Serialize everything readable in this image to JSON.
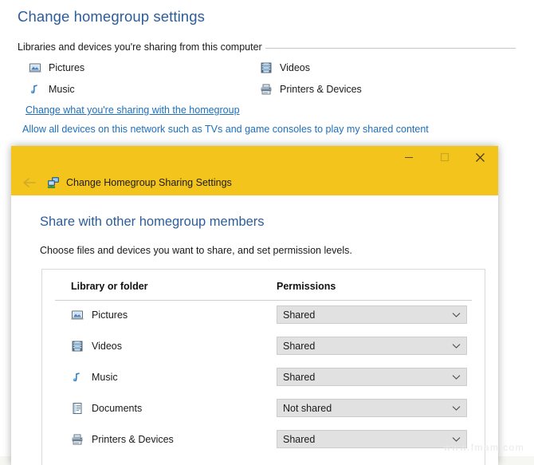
{
  "background_page": {
    "title": "Change homegroup settings",
    "group_label": "Libraries and devices you're sharing from this computer",
    "shared_items": [
      {
        "label": "Pictures",
        "icon": "pictures-icon"
      },
      {
        "label": "Videos",
        "icon": "videos-icon"
      },
      {
        "label": "Music",
        "icon": "music-icon"
      },
      {
        "label": "Printers & Devices",
        "icon": "printer-icon"
      }
    ],
    "links": [
      {
        "label": "Change what you're sharing with the homegroup",
        "underline": true
      },
      {
        "label": "Allow all devices on this network such as TVs and game consoles to play my shared content",
        "underline": false
      }
    ]
  },
  "dialog": {
    "title": "Change Homegroup Sharing Settings",
    "title_icon": "homegroup-icon",
    "back_icon": "back-arrow-icon",
    "window_controls": {
      "minimize": "minimize-icon",
      "maximize": "maximize-icon",
      "close": "close-icon"
    },
    "heading": "Share with other homegroup members",
    "subheading": "Choose files and devices you want to share, and set permission levels.",
    "table": {
      "headers": {
        "library": "Library or folder",
        "permissions": "Permissions"
      },
      "rows": [
        {
          "label": "Pictures",
          "icon": "pictures-icon",
          "permission": "Shared"
        },
        {
          "label": "Videos",
          "icon": "videos-icon",
          "permission": "Shared"
        },
        {
          "label": "Music",
          "icon": "music-icon",
          "permission": "Shared"
        },
        {
          "label": "Documents",
          "icon": "documents-icon",
          "permission": "Not shared"
        },
        {
          "label": "Printers & Devices",
          "icon": "printer-icon",
          "permission": "Shared"
        }
      ],
      "permission_options": [
        "Shared",
        "Not shared"
      ]
    }
  },
  "watermark": "www.fmam.com",
  "colors": {
    "titlebar": "#f3c41b",
    "heading_blue": "#2c5d9b",
    "link_blue": "#1d6fbd",
    "combo_bg": "#e1e1e1"
  }
}
